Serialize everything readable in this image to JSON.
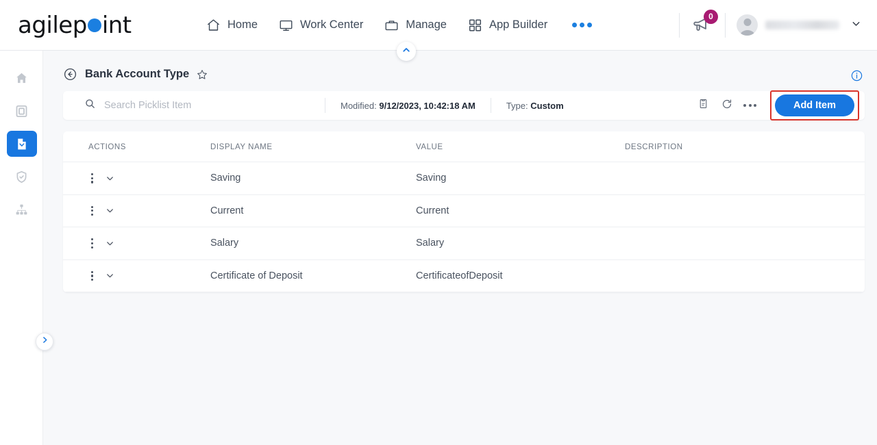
{
  "brand": {
    "name_part1": "agilep",
    "name_part2": "int",
    "accent": "#1b7fe0"
  },
  "topnav": {
    "items": [
      {
        "label": "Home",
        "icon": "home-icon"
      },
      {
        "label": "Work Center",
        "icon": "monitor-icon"
      },
      {
        "label": "Manage",
        "icon": "briefcase-icon"
      },
      {
        "label": "App Builder",
        "icon": "grid-icon"
      }
    ],
    "more_icon": "ellipsis-icon",
    "notification_count": "0",
    "notification_icon": "megaphone-icon",
    "badge_color": "#a81b72",
    "user_chevron_icon": "chevron-down-icon",
    "avatar_icon": "avatar-icon"
  },
  "sidebar": {
    "items": [
      {
        "name": "home",
        "icon": "home-icon",
        "active": false
      },
      {
        "name": "device",
        "icon": "tablet-icon",
        "active": false
      },
      {
        "name": "picklist",
        "icon": "document-chevron-icon",
        "active": true
      },
      {
        "name": "security",
        "icon": "shield-check-icon",
        "active": false
      },
      {
        "name": "hierarchy",
        "icon": "org-chart-icon",
        "active": false
      }
    ],
    "expand_icon": "chevron-right-icon",
    "active_color": "#1877e0"
  },
  "page": {
    "collapse_icon": "chevron-up-icon",
    "back_icon": "back-arrow-circle-icon",
    "title": "Bank Account Type",
    "favorite_icon": "star-icon",
    "info_icon": "info-circle-icon"
  },
  "toolbar": {
    "search_icon": "search-icon",
    "search_value": "",
    "search_placeholder": "Search Picklist Item",
    "modified_label": "Modified:",
    "modified_value": "9/12/2023, 10:42:18 AM",
    "type_label": "Type:",
    "type_value": "Custom",
    "clipboard_icon": "clipboard-icon",
    "refresh_icon": "refresh-icon",
    "more_icon": "ellipsis-icon",
    "add_label": "Add Item",
    "add_color": "#1877e0",
    "highlight_color": "#d9342b"
  },
  "table": {
    "columns": [
      "ACTIONS",
      "DISPLAY NAME",
      "VALUE",
      "DESCRIPTION"
    ],
    "row_menu_icon": "vertical-dots-icon",
    "row_expand_icon": "chevron-down-icon",
    "rows": [
      {
        "display_name": "Saving",
        "value": "Saving",
        "description": ""
      },
      {
        "display_name": "Current",
        "value": "Current",
        "description": ""
      },
      {
        "display_name": "Salary",
        "value": "Salary",
        "description": ""
      },
      {
        "display_name": "Certificate of Deposit",
        "value": "CertificateofDeposit",
        "description": ""
      }
    ]
  }
}
